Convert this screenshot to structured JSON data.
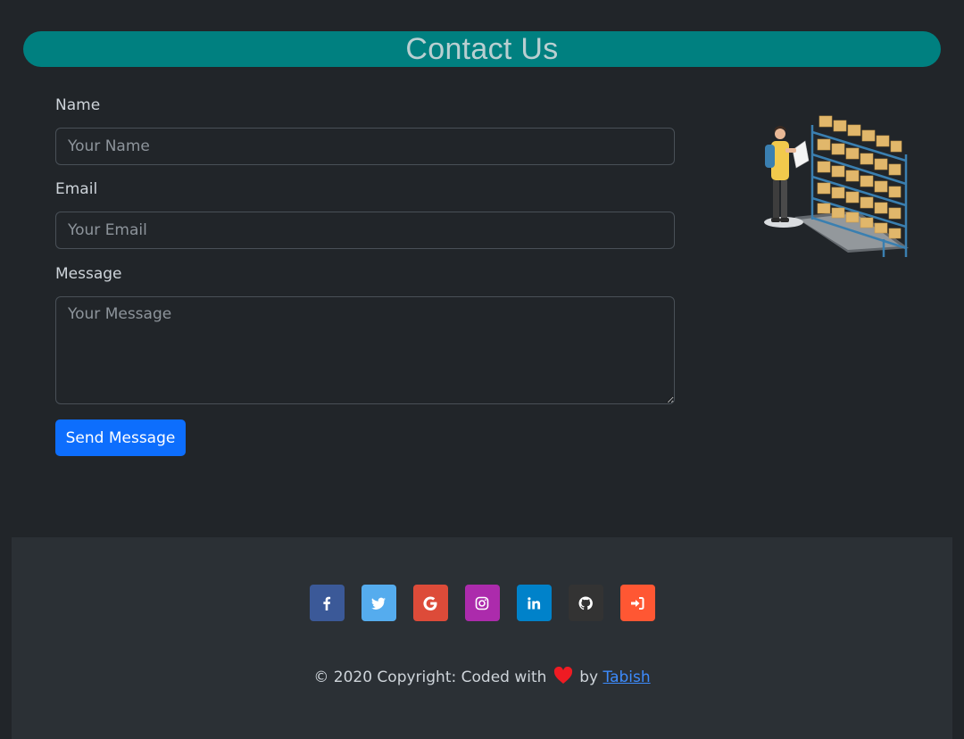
{
  "header": {
    "title": "Contact Us"
  },
  "form": {
    "name_label": "Name",
    "name_placeholder": "Your Name",
    "email_label": "Email",
    "email_placeholder": "Your Email",
    "message_label": "Message",
    "message_placeholder": "Your Message",
    "submit_label": "Send Message"
  },
  "illustration": {
    "icon": "warehouse-shelves-illustration"
  },
  "footer": {
    "socials": [
      {
        "name": "facebook",
        "color": "#3b5998"
      },
      {
        "name": "twitter",
        "color": "#55acee"
      },
      {
        "name": "google",
        "color": "#dd4b39"
      },
      {
        "name": "instagram",
        "color": "#ac2bac"
      },
      {
        "name": "linkedin",
        "color": "#0082ca"
      },
      {
        "name": "github",
        "color": "#333333"
      },
      {
        "name": "login",
        "color": "#ff5733"
      }
    ],
    "copyright_prefix": "© 2020 Copyright: Coded with",
    "copyright_by": "by",
    "author_link": "Tabish"
  }
}
